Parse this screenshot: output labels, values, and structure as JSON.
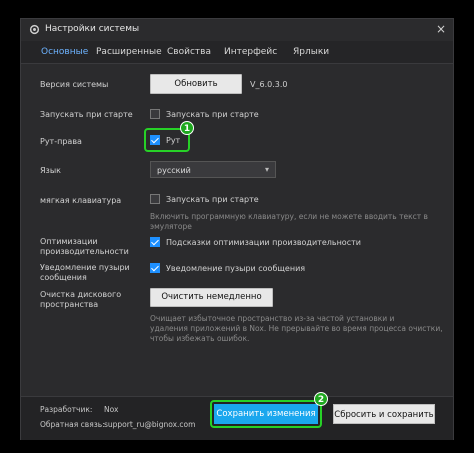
{
  "window": {
    "title": "Настройки системы",
    "close_glyph": "×"
  },
  "tabs": [
    {
      "label": "Основные",
      "active": true
    },
    {
      "label": "Расширенные"
    },
    {
      "label": "Свойства"
    },
    {
      "label": "Интерфейс"
    },
    {
      "label": "Ярлыки"
    }
  ],
  "system_version": {
    "label": "Версия системы",
    "button": "Обновить",
    "value": "V_6.0.3.0"
  },
  "autostart": {
    "label": "Запускать при старте",
    "checkbox_label": "Запускать при старте",
    "checked": false
  },
  "root": {
    "label": "Рут-права",
    "checkbox_label": "Рут",
    "checked": true
  },
  "language": {
    "label": "Язык",
    "value": "русский"
  },
  "soft_keyboard": {
    "label": "мягкая клавиатура",
    "checkbox_label": "Запускать при старте",
    "checked": false,
    "hint_line1": "Включить программную клавиатуру, если не можете вводить текст в",
    "hint_line2": "эмуляторе"
  },
  "optimization": {
    "label_line1": "Оптимизации",
    "label_line2": "производительности",
    "checkbox_label": "Подсказки оптимизации производительности",
    "checked": true
  },
  "notifications": {
    "label_line1": "Уведомление пузыри",
    "label_line2": "сообщения",
    "checkbox_label": "Уведомление пузыри сообщения",
    "checked": true
  },
  "disk_cleanup": {
    "label_line1": "Очистка дискового",
    "label_line2": "пространства",
    "button": "Очистить немедленно",
    "hint_line1": "Очищает избыточное пространство из-за частой установки и",
    "hint_line2": "удаления приложений в Nox. Не прерывайте во время процесса очистки,",
    "hint_line3": "чтобы избежать ошибок."
  },
  "footer": {
    "developer_label": "Разработчик:",
    "developer_value": "Nox",
    "feedback_label": "Обратная связь:",
    "feedback_value": "support_ru@bignox.com",
    "save_button": "Сохранить изменения",
    "reset_button": "Сбросить и сохранить"
  },
  "annotations": {
    "badge1": "1",
    "badge2": "2"
  },
  "colors": {
    "accent": "#1e90ff",
    "save": "#1aa7ee",
    "highlight": "#27d127",
    "active_tab": "#6db3ff"
  }
}
